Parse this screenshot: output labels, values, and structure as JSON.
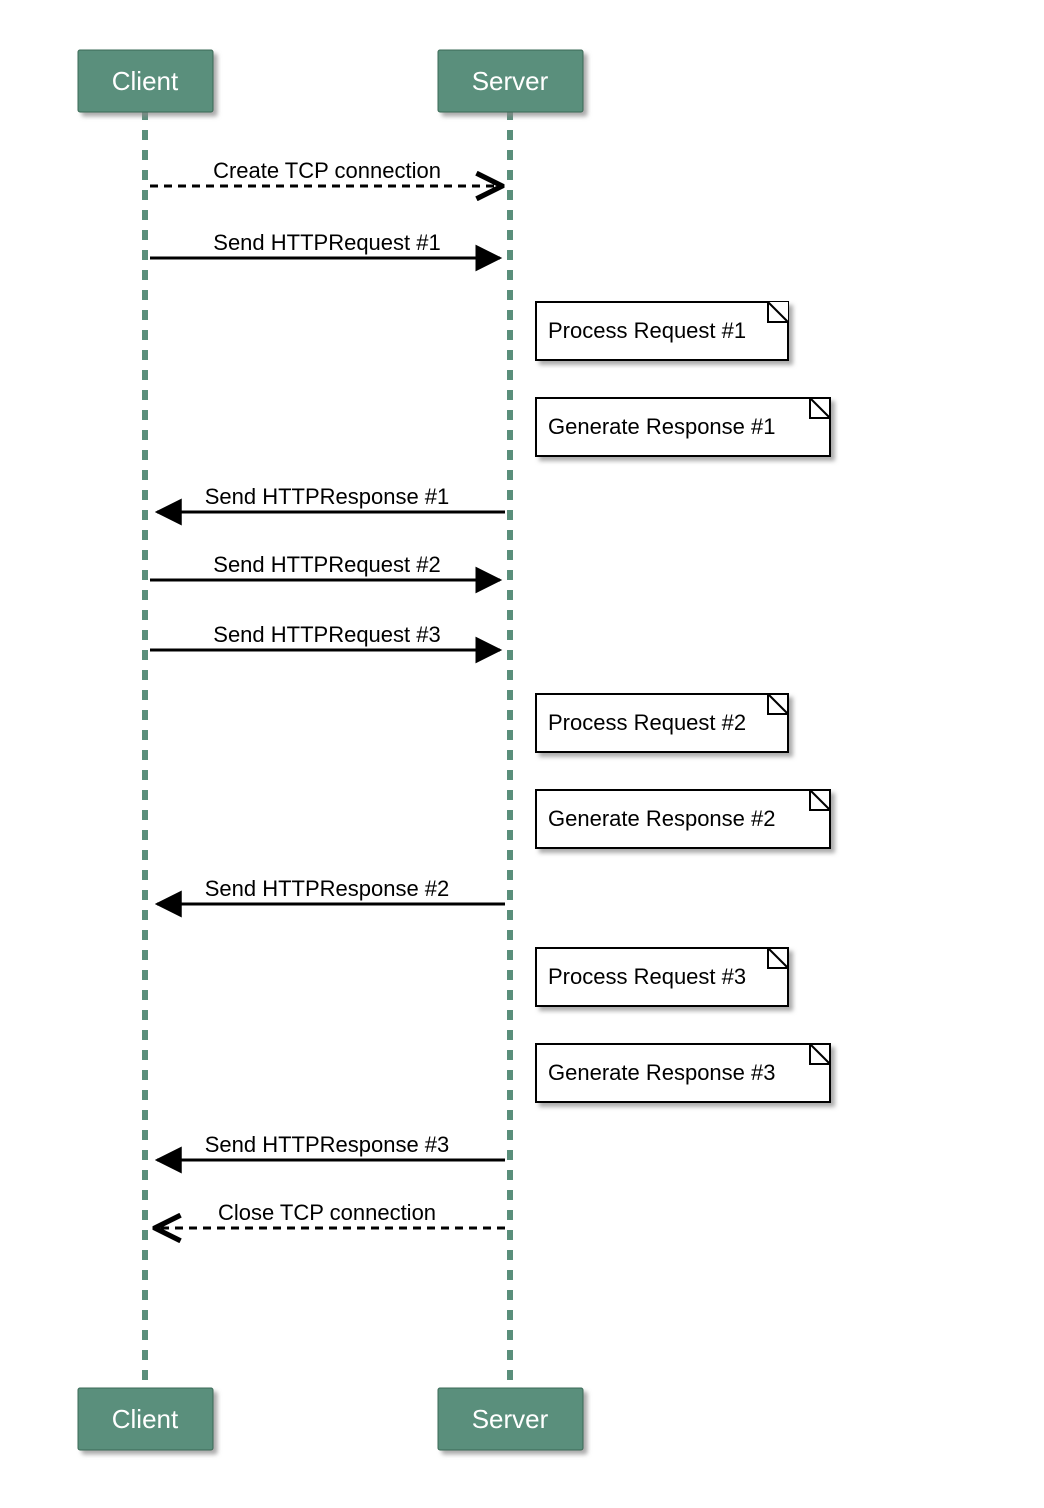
{
  "actors": {
    "client": "Client",
    "server": "Server"
  },
  "messages": {
    "create_tcp": "Create TCP connection",
    "send_req1": "Send HTTPRequest #1",
    "send_resp1": "Send HTTPResponse #1",
    "send_req2": "Send HTTPRequest #2",
    "send_req3": "Send HTTPRequest #3",
    "send_resp2": "Send HTTPResponse #2",
    "send_resp3": "Send HTTPResponse #3",
    "close_tcp": "Close TCP connection"
  },
  "notes": {
    "proc1": "Process Request #1",
    "gen1": "Generate Response #1",
    "proc2": "Process Request #2",
    "gen2": "Generate Response #2",
    "proc3": "Process Request #3",
    "gen3": "Generate Response #3"
  },
  "chart_data": {
    "type": "sequence_diagram",
    "actors": [
      "Client",
      "Server"
    ],
    "events": [
      {
        "kind": "message",
        "from": "Client",
        "to": "Server",
        "label": "Create TCP connection",
        "style": "dashed"
      },
      {
        "kind": "message",
        "from": "Client",
        "to": "Server",
        "label": "Send HTTPRequest #1",
        "style": "solid"
      },
      {
        "kind": "note",
        "at": "Server",
        "label": "Process Request #1"
      },
      {
        "kind": "note",
        "at": "Server",
        "label": "Generate Response #1"
      },
      {
        "kind": "message",
        "from": "Server",
        "to": "Client",
        "label": "Send HTTPResponse #1",
        "style": "solid"
      },
      {
        "kind": "message",
        "from": "Client",
        "to": "Server",
        "label": "Send HTTPRequest #2",
        "style": "solid"
      },
      {
        "kind": "message",
        "from": "Client",
        "to": "Server",
        "label": "Send HTTPRequest #3",
        "style": "solid"
      },
      {
        "kind": "note",
        "at": "Server",
        "label": "Process Request #2"
      },
      {
        "kind": "note",
        "at": "Server",
        "label": "Generate Response #2"
      },
      {
        "kind": "message",
        "from": "Server",
        "to": "Client",
        "label": "Send HTTPResponse #2",
        "style": "solid"
      },
      {
        "kind": "note",
        "at": "Server",
        "label": "Process Request #3"
      },
      {
        "kind": "note",
        "at": "Server",
        "label": "Generate Response #3"
      },
      {
        "kind": "message",
        "from": "Server",
        "to": "Client",
        "label": "Send HTTPResponse #3",
        "style": "solid"
      },
      {
        "kind": "message",
        "from": "Server",
        "to": "Client",
        "label": "Close TCP connection",
        "style": "dashed"
      }
    ]
  }
}
